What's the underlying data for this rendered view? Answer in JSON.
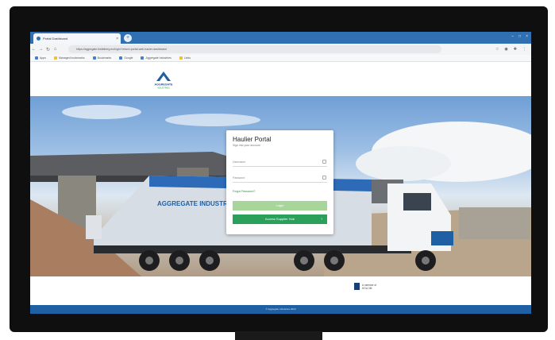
{
  "browser": {
    "tab_title": "Portal Dashboard",
    "tab_close": "×",
    "new_tab": "+",
    "window_controls": [
      "–",
      "□",
      "×"
    ],
    "address": "https://aggregate.leidelberg.eu/login?return=portal-web-hauler-dashboard",
    "nav": [
      "←",
      "→",
      "↻",
      "⌂"
    ],
    "extensions": [
      "☆",
      "◉",
      "✚",
      "⋮"
    ],
    "bookmarks": [
      "Apps",
      "Managed bookmarks",
      "Bookmarks",
      "Google",
      "Aggregate Industries",
      "Links"
    ]
  },
  "site": {
    "logo_text_1": "AGGREGATE",
    "logo_text_2": "INDUSTRIES",
    "login": {
      "title": "Haulier Portal",
      "subtitle": "Sign into your account",
      "username_placeholder": "Username",
      "password_placeholder": "Password",
      "forgot_link": "Forgot Password?",
      "login_button": "Login",
      "register_button": "Access Supplier Hub",
      "register_arrow": "›"
    },
    "truck_text": "AGGREGATE INDUSTRIES",
    "footer_brand_1": "A member of",
    "footer_brand_2": "HOLCIM",
    "footer_copyright": "© Aggregate Industries 2023"
  },
  "colors": {
    "chrome_tab_bar": "#2f6fb2",
    "accent_green": "#2aa05a",
    "button_light_green": "#a7d59a",
    "footer_blue": "#1f5fa3"
  }
}
